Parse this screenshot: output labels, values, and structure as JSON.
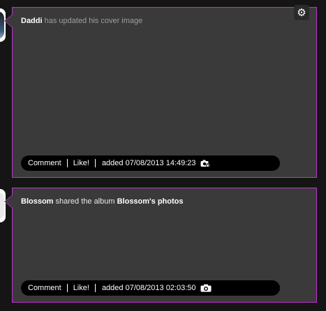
{
  "posts": [
    {
      "user": "Daddi",
      "action_text": "has updated his cover image",
      "actions": {
        "comment": "Comment",
        "like": "Like!"
      },
      "added_label": "added",
      "timestamp": "07/08/2013 14:49:23",
      "type_icon": "camera-refresh-icon",
      "settings_icon": "gear-icon"
    },
    {
      "user": "Blossom",
      "action_text": "shared the album",
      "album": "Blossom's photos",
      "actions": {
        "comment": "Comment",
        "like": "Like!"
      },
      "added_label": "added",
      "timestamp": "07/08/2013 02:03:50",
      "type_icon": "camera-icon"
    }
  ],
  "colors": {
    "accent": "#c22fd6",
    "card": "#3b3a3a",
    "page": "#151515",
    "bar": "#000000"
  }
}
